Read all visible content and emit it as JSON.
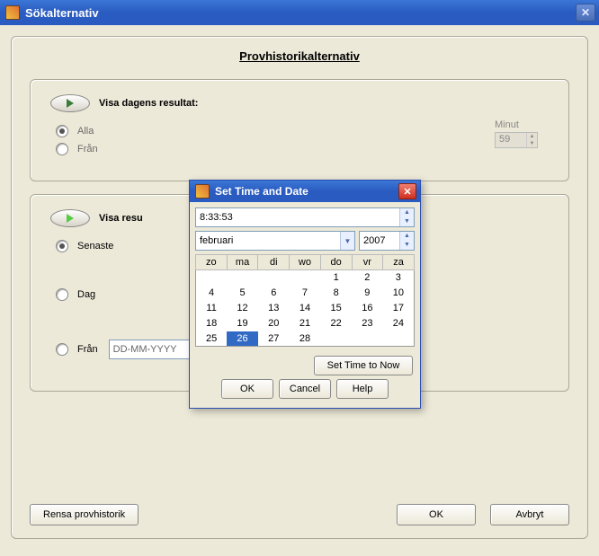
{
  "window": {
    "title": "Sökalternativ"
  },
  "page": {
    "title": "Provhistorikalternativ"
  },
  "section1": {
    "header": "Visa dagens resultat:",
    "radio_all": "Alla",
    "radio_from": "Från",
    "minute_label": "Minut",
    "minute_value": "59"
  },
  "section2": {
    "header": "Visa resu",
    "radio_latest": "Senaste",
    "radio_day": "Dag",
    "radio_from": "Från",
    "date_placeholder": "DD-MM-YYYY"
  },
  "buttons": {
    "clear": "Rensa provhistorik",
    "ok": "OK",
    "cancel": "Avbryt"
  },
  "modal": {
    "title": "Set Time and Date",
    "time": "8:33:53",
    "month": "februari",
    "year": "2007",
    "weekdays": [
      "zo",
      "ma",
      "di",
      "wo",
      "do",
      "vr",
      "za"
    ],
    "weeks": [
      [
        "",
        "",
        "",
        "",
        "1",
        "2",
        "3"
      ],
      [
        "4",
        "5",
        "6",
        "7",
        "8",
        "9",
        "10"
      ],
      [
        "11",
        "12",
        "13",
        "14",
        "15",
        "16",
        "17"
      ],
      [
        "18",
        "19",
        "20",
        "21",
        "22",
        "23",
        "24"
      ],
      [
        "25",
        "26",
        "27",
        "28",
        "",
        "",
        ""
      ]
    ],
    "selected_day": "26",
    "set_now": "Set Time to Now",
    "ok": "OK",
    "cancel": "Cancel",
    "help": "Help"
  }
}
